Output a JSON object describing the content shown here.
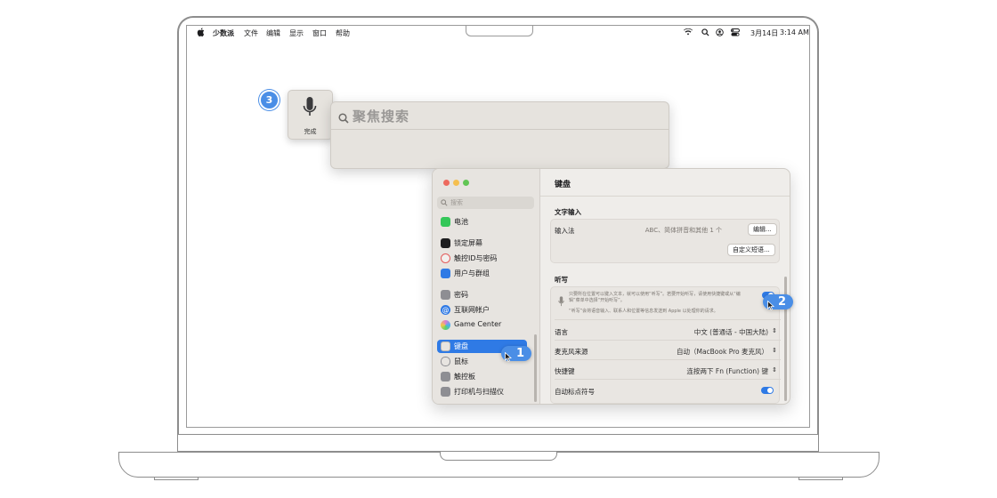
{
  "menubar": {
    "apple": "",
    "app_name": "少数派",
    "items": [
      "文件",
      "编辑",
      "显示",
      "窗口",
      "帮助"
    ],
    "date": "3月14日",
    "time": "3:14 AM",
    "icons": [
      "wifi-icon",
      "spotlight-search-icon",
      "user-icon",
      "control-center-icon"
    ]
  },
  "spotlight": {
    "placeholder": "聚焦搜索",
    "dictation_label": "完成"
  },
  "callouts": {
    "one": "1",
    "two": "2",
    "three": "3"
  },
  "settings": {
    "search_placeholder": "搜索",
    "sidebar": [
      {
        "label": "电池",
        "icon": "battery-icon",
        "color": "#34c759"
      },
      {
        "label": "锁定屏幕",
        "icon": "lock-screen-icon",
        "color": "#1d1d1f"
      },
      {
        "label": "触控ID与密码",
        "icon": "fingerprint-icon",
        "color": "#e35d5d"
      },
      {
        "label": "用户与群组",
        "icon": "users-icon",
        "color": "#2f7ae5"
      },
      {
        "label": "密码",
        "icon": "key-icon",
        "color": "#8e8e93"
      },
      {
        "label": "互联网帐户",
        "icon": "at-icon",
        "color": "#2f7ae5"
      },
      {
        "label": "Game Center",
        "icon": "game-center-icon",
        "color": "#e07bd0"
      },
      {
        "label": "键盘",
        "icon": "keyboard-icon",
        "color": "#8e8e93",
        "selected": true
      },
      {
        "label": "鼠标",
        "icon": "mouse-icon",
        "color": "#8e8e93"
      },
      {
        "label": "触控板",
        "icon": "trackpad-icon",
        "color": "#8e8e93"
      },
      {
        "label": "打印机与扫描仪",
        "icon": "printer-icon",
        "color": "#8e8e93"
      }
    ],
    "title": "键盘",
    "text_input": {
      "heading": "文字输入",
      "input_method_label": "输入法",
      "input_method_value": "ABC、简体拼音和其他 1 个",
      "edit_button": "编辑...",
      "custom_phrase_button": "自定义短语..."
    },
    "dictation": {
      "heading": "听写",
      "hint1": "只要所在位置可以键入文本，就可以使用“听写”。若要开始听写，请使用快捷键或从“编辑”菜单中选择“开始听写”。",
      "hint2": "“听写”会将语音输入、联系人和位置等信息发送到 Apple 以处理你的请求。",
      "enabled": true,
      "language_label": "语言",
      "language_value": "中文 (普通话 - 中国大陆)",
      "mic_label": "麦克风来源",
      "mic_value": "自动（MacBook Pro 麦克风）",
      "shortcut_label": "快捷键",
      "shortcut_value": "连按两下 Fn (Function) 键",
      "auto_punct_label": "自动标点符号",
      "auto_punct": true
    }
  },
  "colors": {
    "accent": "#2f7ae5",
    "callout": "#4a8ee6"
  }
}
